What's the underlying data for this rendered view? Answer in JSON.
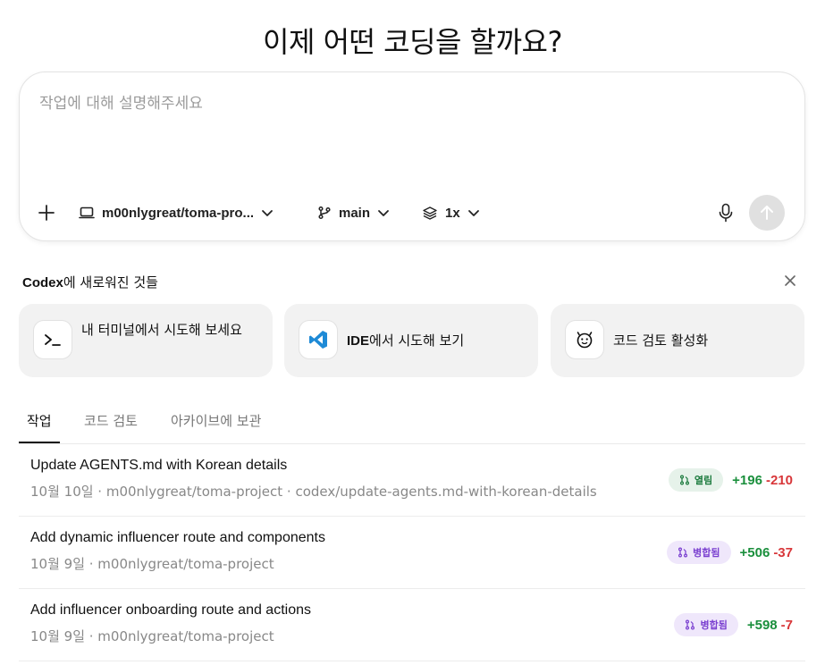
{
  "heading": "이제 어떤 코딩을 할까요?",
  "composer": {
    "placeholder": "작업에 대해 설명해주세요",
    "repo": "m00nlygreat/toma-pro...",
    "branch": "main",
    "multiplier": "1x"
  },
  "whats_new": {
    "brand": "Codex",
    "title_suffix": "에 새로워진 것들",
    "cards": [
      {
        "label": "내 터미널에서 시도해 보세요",
        "icon": "terminal-icon"
      },
      {
        "label_bold": "IDE",
        "label_rest": "에서 시도해 보기",
        "icon": "vscode-icon"
      },
      {
        "label": "코드 검토 활성화",
        "icon": "code-review-icon"
      }
    ]
  },
  "tabs": [
    "작업",
    "코드 검토",
    "아카이브에 보관"
  ],
  "tasks": [
    {
      "title": "Update AGENTS.md with Korean details",
      "meta": "10월 10일 · m00nlygreat/toma-project · codex/update-agents.md-with-korean-details",
      "status": "열림",
      "additions": "+196",
      "deletions": "-210"
    },
    {
      "title": "Add dynamic influencer route and components",
      "meta": "10월 9일 · m00nlygreat/toma-project",
      "status": "병합됨",
      "additions": "+506",
      "deletions": "-37"
    },
    {
      "title": "Add influencer onboarding route and actions",
      "meta": "10월 9일 · m00nlygreat/toma-project",
      "status": "병합됨",
      "additions": "+598",
      "deletions": "-7"
    }
  ],
  "colors": {
    "accent_green": "#1a8f3c",
    "accent_red": "#d8373a",
    "merged_purple": "#7a3fd0",
    "vscode_blue": "#1e8ad6"
  }
}
